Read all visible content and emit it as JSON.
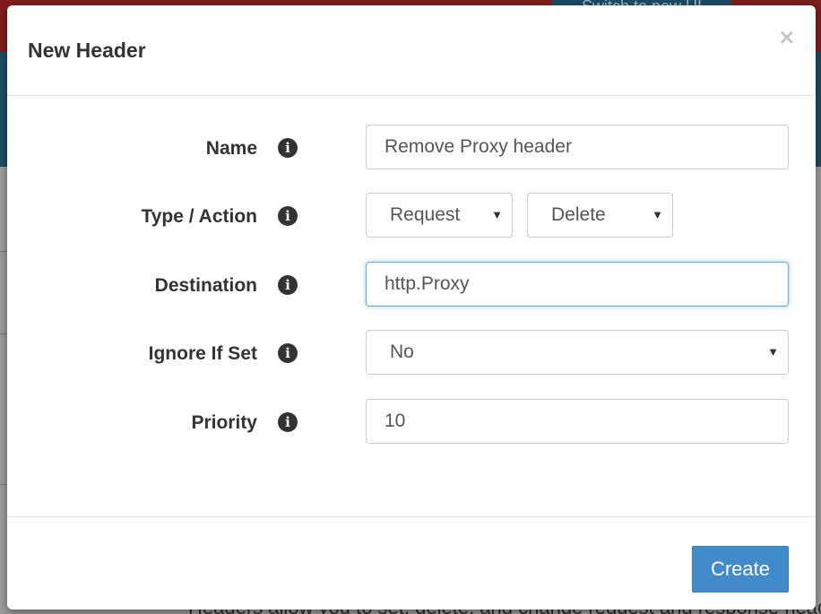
{
  "background": {
    "switch_label": "Switch to new UI",
    "footer_text": "Headers allow you to set, delete, and change request and response headers."
  },
  "modal": {
    "title": "New Header",
    "close_symbol": "×",
    "info_glyph": "i",
    "fields": {
      "name": {
        "label": "Name",
        "value": "Remove Proxy header"
      },
      "type_action": {
        "label": "Type / Action",
        "type_value": "Request",
        "action_value": "Delete"
      },
      "destination": {
        "label": "Destination",
        "value": "http.Proxy"
      },
      "ignore_if_set": {
        "label": "Ignore If Set",
        "value": "No"
      },
      "priority": {
        "label": "Priority",
        "value": "10"
      }
    },
    "create_label": "Create"
  },
  "colors": {
    "primary": "#428bca",
    "focus": "#66afe9"
  },
  "icons": {
    "info": "info-icon",
    "close": "close-icon",
    "caret": "caret-down-icon"
  }
}
